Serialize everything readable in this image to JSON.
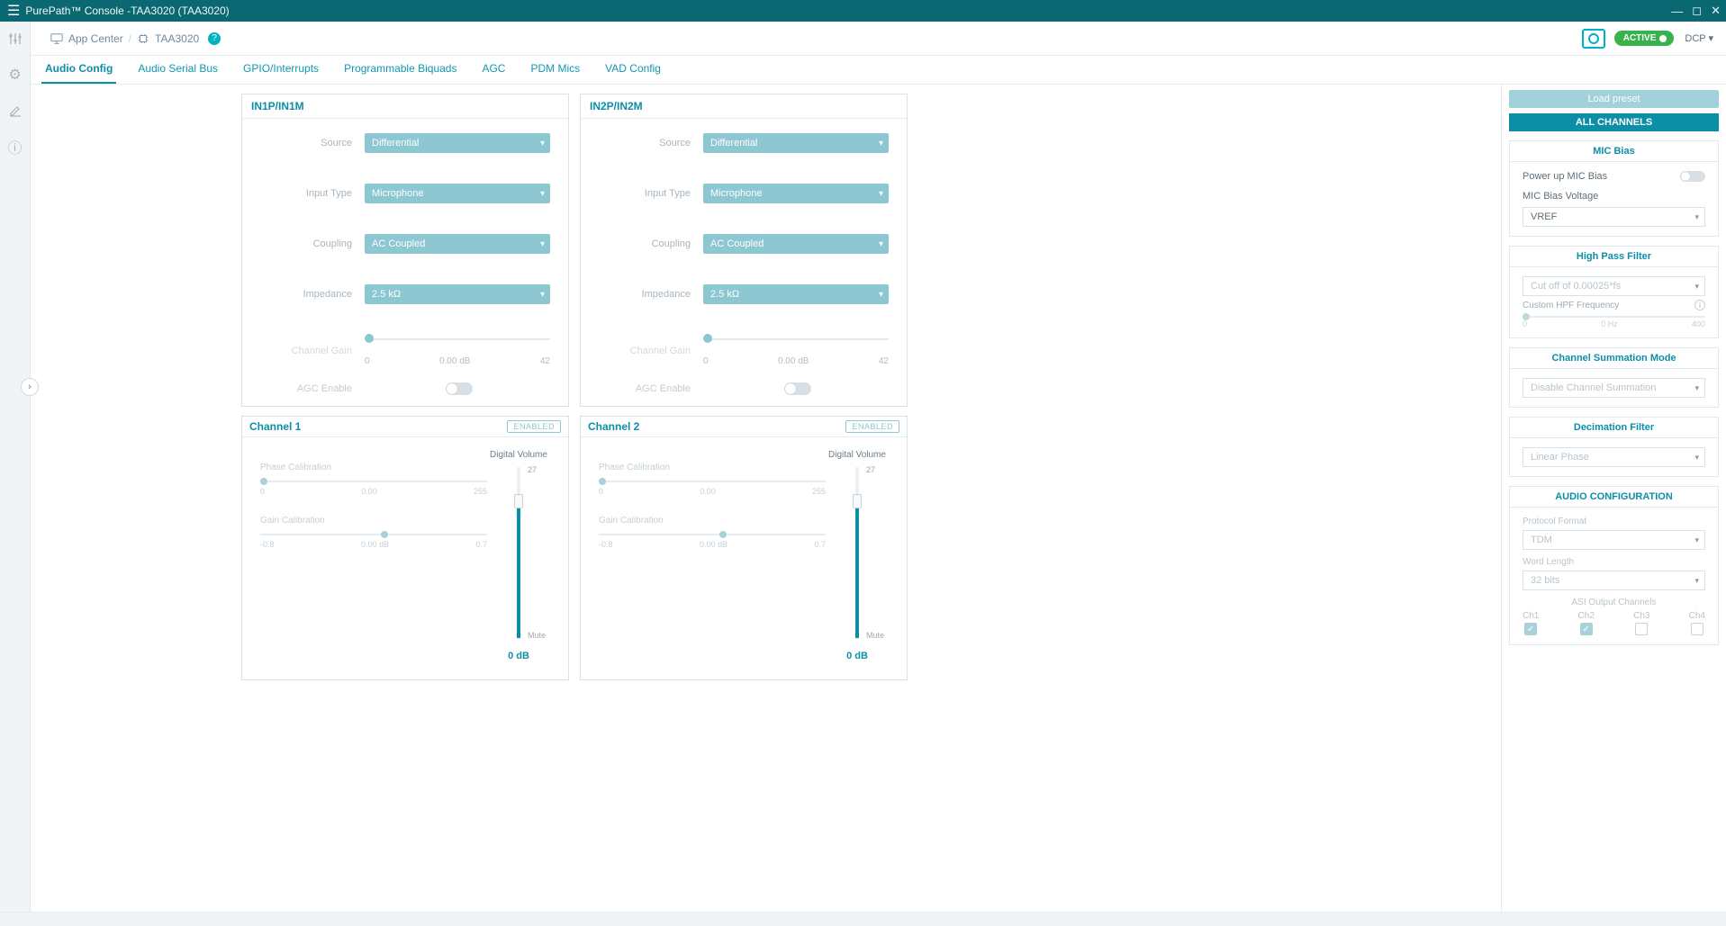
{
  "window": {
    "title": "PurePath™ Console -TAA3020 (TAA3020)"
  },
  "breadcrumb": {
    "app_center": "App Center",
    "device": "TAA3020"
  },
  "topbar": {
    "active": "ACTIVE",
    "dcp": "DCP ▾"
  },
  "tabs": [
    "Audio Config",
    "Audio Serial Bus",
    "GPIO/Interrupts",
    "Programmable Biquads",
    "AGC",
    "PDM Mics",
    "VAD Config"
  ],
  "active_tab": 0,
  "in_cards": [
    {
      "title": "IN1P/IN1M",
      "source": "Differential",
      "input_type": "Microphone",
      "coupling": "AC Coupled",
      "impedance": "2.5 kΩ",
      "gain": "0.00 dB",
      "gain_min": "0",
      "gain_max": "42",
      "agc": false
    },
    {
      "title": "IN2P/IN2M",
      "source": "Differential",
      "input_type": "Microphone",
      "coupling": "AC Coupled",
      "impedance": "2.5 kΩ",
      "gain": "0.00 dB",
      "gain_min": "0",
      "gain_max": "42",
      "agc": false
    }
  ],
  "field_labels": {
    "source": "Source",
    "input_type": "Input Type",
    "coupling": "Coupling",
    "impedance": "Impedance",
    "ch_gain": "Channel Gain",
    "agc": "AGC Enable"
  },
  "channels": [
    {
      "title": "Channel 1",
      "enabled": "ENABLED",
      "phase_lbl": "Phase Calibration",
      "phase_val": "0.00",
      "phase_min": "0",
      "phase_max": "255",
      "gc_lbl": "Gain Calibration",
      "gc_val": "0.00 dB",
      "gc_min": "-0.8",
      "gc_max": "0.7",
      "dv_lbl": "Digital Volume",
      "dv_hi": "27",
      "dv_lo": "Mute",
      "db": "0 dB"
    },
    {
      "title": "Channel 2",
      "enabled": "ENABLED",
      "phase_lbl": "Phase Calibration",
      "phase_val": "0.00",
      "phase_min": "0",
      "phase_max": "255",
      "gc_lbl": "Gain Calibration",
      "gc_val": "0.00 dB",
      "gc_min": "-0.8",
      "gc_max": "0.7",
      "dv_lbl": "Digital Volume",
      "dv_hi": "27",
      "dv_lo": "Mute",
      "db": "0 dB"
    }
  ],
  "right": {
    "load": "Load preset",
    "all": "ALL CHANNELS",
    "mic": {
      "title": "MIC Bias",
      "power": "Power up MIC Bias",
      "volt_lbl": "MIC Bias Voltage",
      "volt": "VREF"
    },
    "hpf": {
      "title": "High Pass Filter",
      "cutoff": "Cut off of 0.00025*fs",
      "custom": "Custom HPF Frequency",
      "val": "0 Hz",
      "min": "0",
      "max": "400"
    },
    "sum": {
      "title": "Channel Summation Mode",
      "val": "Disable Channel Summation"
    },
    "dec": {
      "title": "Decimation Filter",
      "val": "Linear Phase"
    },
    "ac": {
      "title": "AUDIO CONFIGURATION",
      "proto_lbl": "Protocol Format",
      "proto": "TDM",
      "word_lbl": "Word Length",
      "word": "32 bits",
      "asi": "ASI Output Channels",
      "ch": [
        "Ch1",
        "Ch2",
        "Ch3",
        "Ch4"
      ],
      "chk": [
        true,
        true,
        false,
        false
      ]
    }
  }
}
